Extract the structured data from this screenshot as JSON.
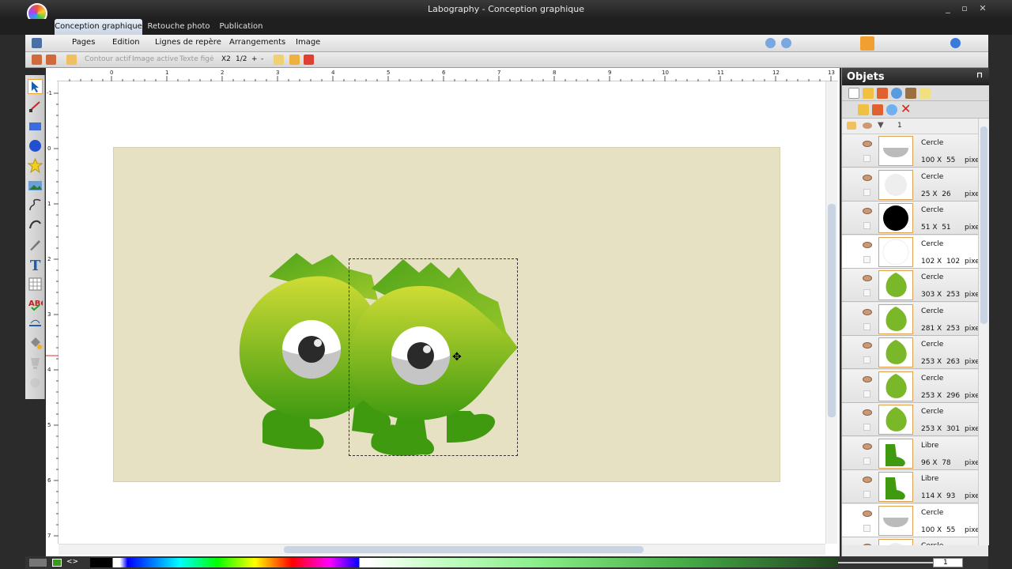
{
  "window": {
    "title": "Labography - Conception graphique",
    "controls": [
      "_",
      "▫",
      "✕"
    ]
  },
  "tabs": [
    {
      "label": "Conception graphique",
      "active": true
    },
    {
      "label": "Retouche photo"
    },
    {
      "label": "Publication"
    }
  ],
  "menu": {
    "items": [
      "Pages",
      "Edition",
      "Lignes de repère",
      "Arrangements",
      "Image"
    ]
  },
  "toolbar": {
    "contour": "Contour actif",
    "image_active": "Image active",
    "texte_fige": "Texte figé",
    "zoom_factor": "X2",
    "page_fraction": "1/2",
    "plus": "+",
    "minus": "-"
  },
  "rulers": {
    "horizontal": [
      "0",
      "1",
      "2",
      "3",
      "4",
      "5",
      "6",
      "7",
      "8",
      "9",
      "10",
      "11",
      "12",
      "13"
    ],
    "vertical": [
      "-1",
      "0",
      "1",
      "2",
      "3",
      "4",
      "5",
      "6",
      "7"
    ]
  },
  "panel": {
    "title": "Objets",
    "pin": "⊓",
    "layer": "1",
    "objects": [
      {
        "type": "Cercle",
        "w": "100",
        "h": "55",
        "unit": "pixels",
        "thumb": "gray-half"
      },
      {
        "type": "Cercle",
        "w": "25",
        "h": "26",
        "unit": "pixels",
        "thumb": "light-circle"
      },
      {
        "type": "Cercle",
        "w": "51",
        "h": "51",
        "unit": "pixels",
        "thumb": "black-circle"
      },
      {
        "type": "Cercle",
        "w": "102",
        "h": "102",
        "unit": "pixels",
        "thumb": "white-circle"
      },
      {
        "type": "Cercle",
        "w": "303",
        "h": "253",
        "unit": "pixels",
        "thumb": "green-drop"
      },
      {
        "type": "Cercle",
        "w": "281",
        "h": "253",
        "unit": "pixels",
        "thumb": "green-drop"
      },
      {
        "type": "Cercle",
        "w": "253",
        "h": "263",
        "unit": "pixels",
        "thumb": "green-drop"
      },
      {
        "type": "Cercle",
        "w": "253",
        "h": "296",
        "unit": "pixels",
        "thumb": "green-drop"
      },
      {
        "type": "Cercle",
        "w": "253",
        "h": "301",
        "unit": "pixels",
        "thumb": "green-drop"
      },
      {
        "type": "Libre",
        "w": "96",
        "h": "78",
        "unit": "pixels",
        "thumb": "green-foot"
      },
      {
        "type": "Libre",
        "w": "114",
        "h": "93",
        "unit": "pixels",
        "thumb": "green-foot"
      },
      {
        "type": "Cercle",
        "w": "100",
        "h": "55",
        "unit": "pixels",
        "thumb": "gray-half"
      },
      {
        "type": "Cercle",
        "w": "",
        "h": "",
        "unit": "",
        "thumb": "light-circle"
      }
    ]
  },
  "bottom": {
    "code_toggle": "<>",
    "zoom_value": "1"
  },
  "colors": {
    "page_bg": "#e7e1c4",
    "monster_green_light": "#cfdc35",
    "monster_green_dark": "#3f9a10",
    "selection": "#333333",
    "accent_tab": "#dfe7f2"
  }
}
